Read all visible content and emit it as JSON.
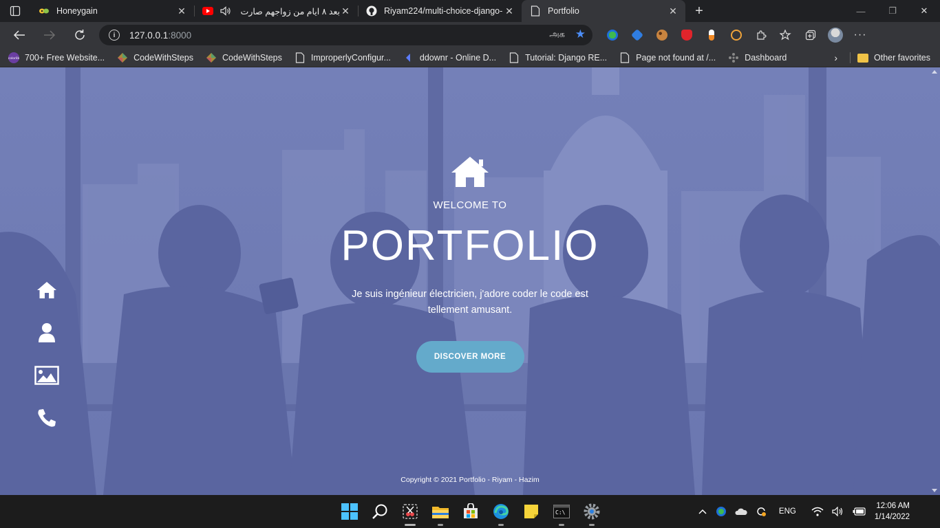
{
  "browser": {
    "tabs": [
      {
        "title": "Honeygain",
        "favicon": "honeygain-icon",
        "active": false
      },
      {
        "title": "بعد ٨ ايام من زواجهم صارت",
        "favicon": "youtube-icon",
        "muted_audio_icon": "speaker-icon",
        "active": false
      },
      {
        "title": "Riyam224/multi-choice-django-",
        "favicon": "github-icon",
        "active": false
      },
      {
        "title": "Portfolio",
        "favicon": "page-icon",
        "active": true
      }
    ],
    "url_host": "127.0.0.1",
    "url_port": ":8000",
    "translate_glyph": "அக",
    "bookmarks": [
      {
        "label": "700+ Free Website...",
        "icon": "colorlib-icon"
      },
      {
        "label": "CodeWithSteps",
        "icon": "codewithsteps-icon"
      },
      {
        "label": "CodeWithSteps",
        "icon": "codewithsteps-icon"
      },
      {
        "label": "ImproperlyConfigur...",
        "icon": "page-icon"
      },
      {
        "label": "ddownr - Online D...",
        "icon": "ddownr-icon"
      },
      {
        "label": "Tutorial: Django RE...",
        "icon": "page-icon"
      },
      {
        "label": "Page not found at /...",
        "icon": "page-icon"
      },
      {
        "label": "Dashboard",
        "icon": "dashboard-icon"
      }
    ],
    "other_favorites": "Other favorites"
  },
  "page": {
    "welcome": "WELCOME TO",
    "title": "PORTFOLIO",
    "description": "Je suis ingénieur électricien, j'adore coder le code est tellement amusant.",
    "cta": "DISCOVER MORE",
    "copyright": "Copyright © 2021 Portfolio - Riyam - Hazim",
    "sidenav": [
      "home-icon",
      "user-icon",
      "image-icon",
      "phone-icon"
    ],
    "colors": {
      "overlay": "#6571ab",
      "button": "#64aacb"
    }
  },
  "taskbar": {
    "apps": [
      "windows-start-icon",
      "search-icon",
      "snipping-tool-icon",
      "file-explorer-icon",
      "microsoft-store-icon",
      "edge-icon",
      "sticky-notes-icon",
      "terminal-icon",
      "settings-icon"
    ],
    "language": "ENG",
    "time": "12:06 AM",
    "date": "1/14/2022"
  }
}
